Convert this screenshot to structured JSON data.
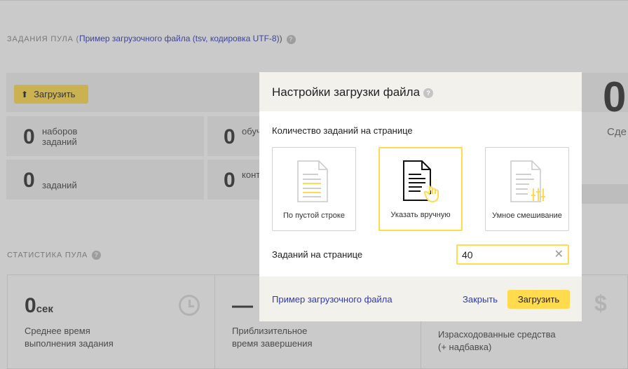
{
  "background": {
    "section_title_prefix": "ЗАДАНИЯ ПУЛА (",
    "section_link": "Пример загрузочного файла (tsv, кодировка UTF-8)",
    "section_title_suffix": ")",
    "help_mark": "?",
    "upload_button": "Загрузить",
    "stats": [
      {
        "value": "0",
        "label": "наборов заданий"
      },
      {
        "value": "0",
        "label": "обучающих заданий"
      },
      {
        "value": "0",
        "label": "заданий"
      },
      {
        "value": "0",
        "label": "контрольных заданий"
      }
    ],
    "side_value": "0",
    "side_label": "Сде",
    "pool_stats_title": "СТАТИСТИКА ПУЛА",
    "pool_cards": [
      {
        "value": "0",
        "unit": "сек",
        "label": "Среднее время выполнения задания"
      },
      {
        "value": "—",
        "unit": "",
        "label": "Приблизительное время завершения"
      },
      {
        "value": "",
        "unit": "",
        "label": "Израсходованные средства (+ надбавка)"
      }
    ],
    "dollar_glyph": "$"
  },
  "modal": {
    "title": "Настройки загрузки файла",
    "help_mark": "?",
    "tasks_per_page_label": "Количество заданий на странице",
    "options": [
      {
        "label": "По пустой строке",
        "selected": false,
        "icon": "document-lines-icon"
      },
      {
        "label": "Указать вручную",
        "selected": true,
        "icon": "document-hand-icon"
      },
      {
        "label": "Умное смешивание",
        "selected": false,
        "icon": "document-sliders-icon"
      }
    ],
    "count_label": "Заданий на странице",
    "count_value": "40",
    "footer": {
      "example_link": "Пример загрузочного файла",
      "close_label": "Закрыть",
      "upload_label": "Загрузить"
    }
  },
  "colors": {
    "accent": "#ffdb4d",
    "link": "#2e39b8",
    "panel": "#f2f2f2",
    "modal_header": "#f2f1ec"
  }
}
